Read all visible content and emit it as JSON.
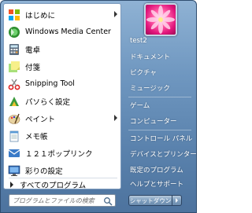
{
  "programs": [
    {
      "label": "はじめに",
      "icon": "getting-started-icon",
      "has_submenu": true
    },
    {
      "label": "Windows Media Center",
      "icon": "media-center-icon",
      "has_submenu": false
    },
    {
      "label": "電卓",
      "icon": "calculator-icon",
      "has_submenu": false
    },
    {
      "label": "付箋",
      "icon": "sticky-notes-icon",
      "has_submenu": false
    },
    {
      "label": "Snipping Tool",
      "icon": "scissors-icon",
      "has_submenu": false
    },
    {
      "label": "パソらく設定",
      "icon": "pasoraku-settings-icon",
      "has_submenu": false
    },
    {
      "label": "ペイント",
      "icon": "paint-icon",
      "has_submenu": true
    },
    {
      "label": "メモ帳",
      "icon": "notepad-icon",
      "has_submenu": false
    },
    {
      "label": "１２１ポップリンク",
      "icon": "poplink-icon",
      "has_submenu": false
    },
    {
      "label": "彩りの設定",
      "icon": "color-settings-icon",
      "has_submenu": false
    }
  ],
  "all_programs_label": "すべてのプログラム",
  "search": {
    "placeholder": "プログラムとファイルの検索"
  },
  "user": {
    "name": "test2"
  },
  "right_items": [
    {
      "label": "test2"
    },
    {
      "label": "ドキュメント"
    },
    {
      "label": "ピクチャ"
    },
    {
      "label": "ミュージック"
    },
    {
      "label": "ゲーム"
    },
    {
      "label": "コンピューター"
    },
    {
      "label": "コントロール パネル"
    },
    {
      "label": "デバイスとプリンター"
    },
    {
      "label": "既定のプログラム"
    },
    {
      "label": "ヘルプとサポート"
    }
  ],
  "shutdown": {
    "label": "シャットダウン"
  }
}
